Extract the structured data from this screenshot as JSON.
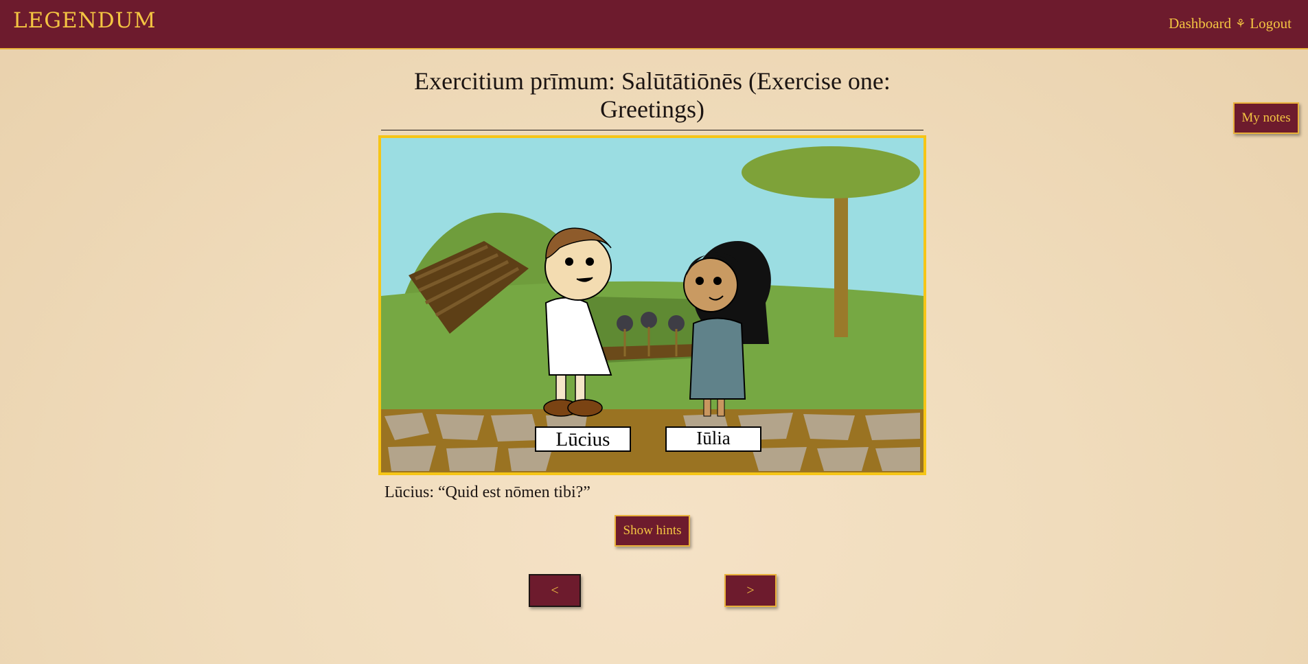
{
  "header": {
    "logo": "LEGENDUM",
    "nav": {
      "dashboard": "Dashboard",
      "separator": "⚘",
      "logout": "Logout"
    }
  },
  "exercise": {
    "title": "Exercitium prīmum: Salūtātiōnēs (Exercise one: Greetings)",
    "scene": {
      "labels": {
        "left": "Lūcius",
        "right": "Iūlia"
      }
    },
    "dialogue": "Lūcius: “Quid est nōmen tibi?”"
  },
  "buttons": {
    "hints": "Show hints",
    "prev": "<",
    "next": ">",
    "notes": "My notes"
  },
  "colors": {
    "header_bg": "#6d1b2d",
    "accent": "#f4c542",
    "frame": "#f6c516"
  },
  "icons": {
    "nav_separator": "flower-icon"
  }
}
